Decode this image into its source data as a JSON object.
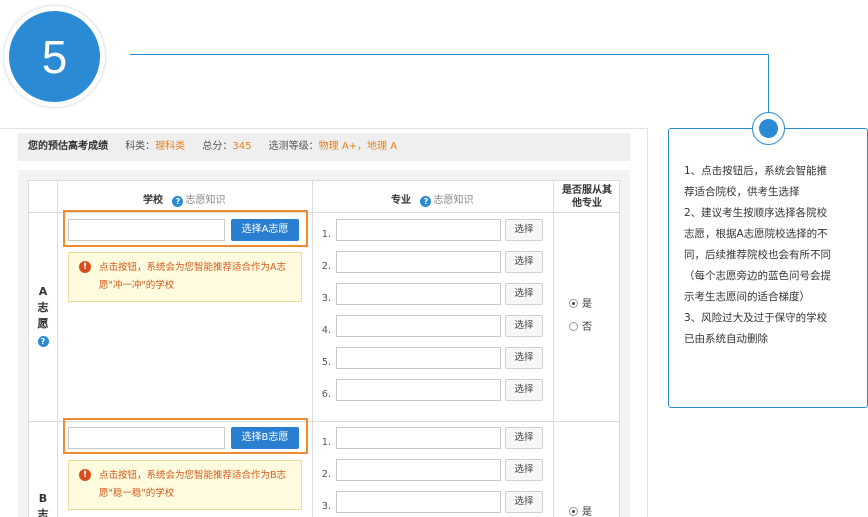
{
  "step": "5",
  "score_bar": {
    "title": "您的预估高考成绩",
    "subject_key": "科类：",
    "subject_val": "理科类",
    "total_key": "总分：",
    "total_val": "345",
    "level_key": "选测等级：",
    "level_val": "物理 A+，地理 A"
  },
  "table": {
    "col_school": "学校",
    "col_major": "专业",
    "help_text": "志愿知识",
    "col_accept": "是否服从其他专业",
    "rows": [
      {
        "label": "A志愿",
        "button": "选择A志愿",
        "tip": "点击按钮，系统会为您智能推荐适合作为A志愿\"冲一冲\"的学校"
      },
      {
        "label": "B志",
        "button": "选择B志愿",
        "tip": "点击按钮，系统会为您智能推荐适合作为B志愿\"稳一稳\"的学校"
      }
    ],
    "major_numbers": [
      "1.",
      "2.",
      "3.",
      "4.",
      "5.",
      "6."
    ],
    "select_label": "选择",
    "yes": "是",
    "no": "否"
  },
  "note": {
    "lines": [
      "1、点击按钮后，系统会智能推",
      "荐适合院校，供考生选择",
      "2、建议考生按顺序选择各院校",
      "志愿，根据A志愿院校选择的不",
      "同，后续推荐院校也会有所不同",
      "（每个志愿旁边的蓝色问号会提",
      "示考生志愿间的适合梯度）",
      "3、风险过大及过于保守的学校",
      "已由系统自动删除"
    ]
  },
  "colors": {
    "accent": "#2a8ad4",
    "highlight": "#f08a2e",
    "score": "#e8821a",
    "tip_text": "#d55a1a"
  }
}
